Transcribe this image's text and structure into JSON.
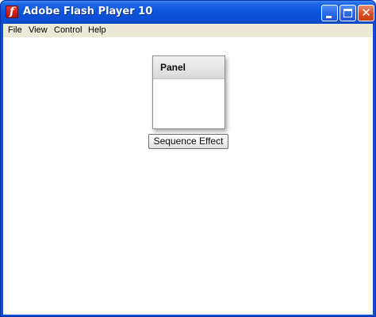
{
  "window": {
    "title": "Adobe Flash Player 10",
    "app_icon": "flash-player-icon",
    "app_icon_glyph": "f",
    "controls": {
      "minimize_icon": "minimize-icon",
      "maximize_icon": "maximize-icon",
      "close_icon": "close-icon",
      "close_glyph": "✕"
    }
  },
  "menubar": {
    "items": [
      {
        "label": "File"
      },
      {
        "label": "View"
      },
      {
        "label": "Control"
      },
      {
        "label": "Help"
      }
    ]
  },
  "stage": {
    "panel": {
      "title": "Panel"
    },
    "sequence_button": {
      "label": "Sequence Effect"
    }
  },
  "colors": {
    "titlebar": "#0a56dd",
    "close_button": "#d9542c",
    "menubar": "#ece9d8",
    "stage_background": "#ffffff",
    "panel_header": "#e3e3e3"
  }
}
